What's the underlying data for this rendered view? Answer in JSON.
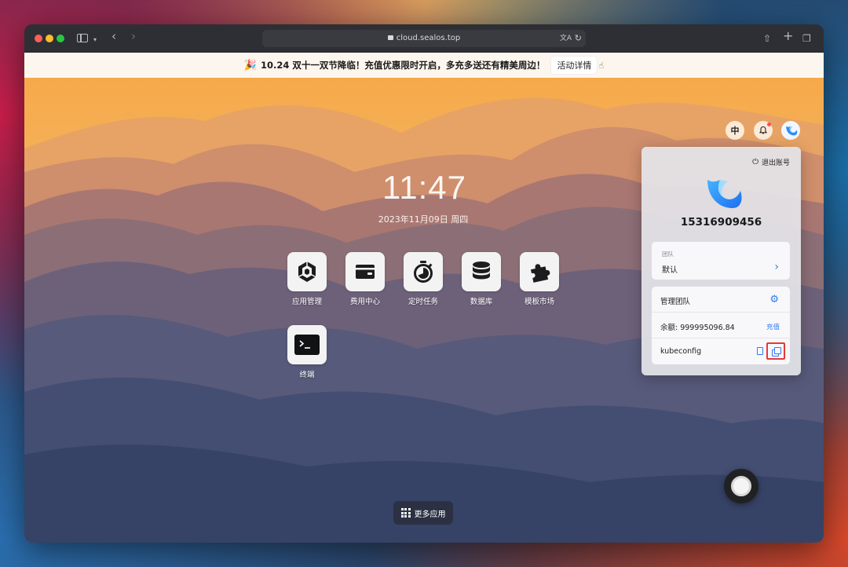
{
  "browser": {
    "url": "cloud.sealos.top"
  },
  "banner": {
    "emoji": "🎉",
    "text": "10.24 双十一双节降临！充值优惠限时开启，多充多送还有精美周边！",
    "button": "活动详情"
  },
  "desktop": {
    "lang_button": "中",
    "time": "11:47",
    "date": "2023年11月09日 周四",
    "apps": [
      {
        "label": "应用管理",
        "icon": "app-manage-icon"
      },
      {
        "label": "费用中心",
        "icon": "wallet-icon"
      },
      {
        "label": "定时任务",
        "icon": "timer-icon"
      },
      {
        "label": "数据库",
        "icon": "database-icon"
      },
      {
        "label": "模板市场",
        "icon": "puzzle-icon"
      },
      {
        "label": "终端",
        "icon": "terminal-icon"
      }
    ],
    "more_apps": "更多应用"
  },
  "account_panel": {
    "logout": "退出账号",
    "phone": "15316909456",
    "team_caption": "团队",
    "team_value": "默认",
    "manage_team": "管理团队",
    "balance": "余额: 999995096.84",
    "recharge": "充值",
    "kubeconfig": "kubeconfig"
  },
  "colors": {
    "accent": "#2f7bf6",
    "highlight": "#e53935"
  }
}
